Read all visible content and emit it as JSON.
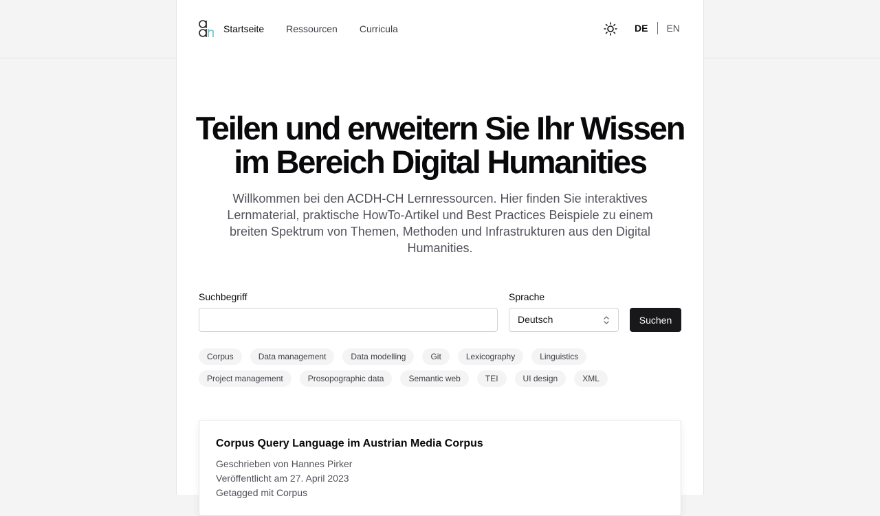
{
  "header": {
    "nav": [
      "Startseite",
      "Ressourcen",
      "Curricula"
    ],
    "active_nav": "Startseite",
    "theme_icon": "sun-icon",
    "lang_de": "DE",
    "lang_en": "EN"
  },
  "hero": {
    "title_line1": "Teilen und erweitern Sie Ihr Wissen",
    "title_line2": "im Bereich Digital Humanities",
    "subtitle": "Willkommen bei den ACDH-CH Lernressourcen. Hier finden Sie interaktives Lernmaterial, praktische HowTo-Artikel und Best Practices Beispiele zu einem breiten Spektrum von Themen, Methoden und Infrastrukturen aus den Digital Humanities."
  },
  "search": {
    "term_label": "Suchbegriff",
    "term_value": "",
    "language_label": "Sprache",
    "language_value": "Deutsch",
    "button": "Suchen"
  },
  "tags": [
    "Corpus",
    "Data management",
    "Data modelling",
    "Git",
    "Lexicography",
    "Linguistics",
    "Project management",
    "Prosopographic data",
    "Semantic web",
    "TEI",
    "UI design",
    "XML"
  ],
  "results": [
    {
      "title": "Corpus Query Language im Austrian Media Corpus",
      "author": "Geschrieben von Hannes Pirker",
      "published": "Veröffentlicht am 27. April 2023",
      "tagged": "Getagged mit Corpus"
    }
  ],
  "colors": {
    "background": "#f4f4f5",
    "primary_button": "#18181b",
    "logo_accent": "#5fc4c9"
  }
}
